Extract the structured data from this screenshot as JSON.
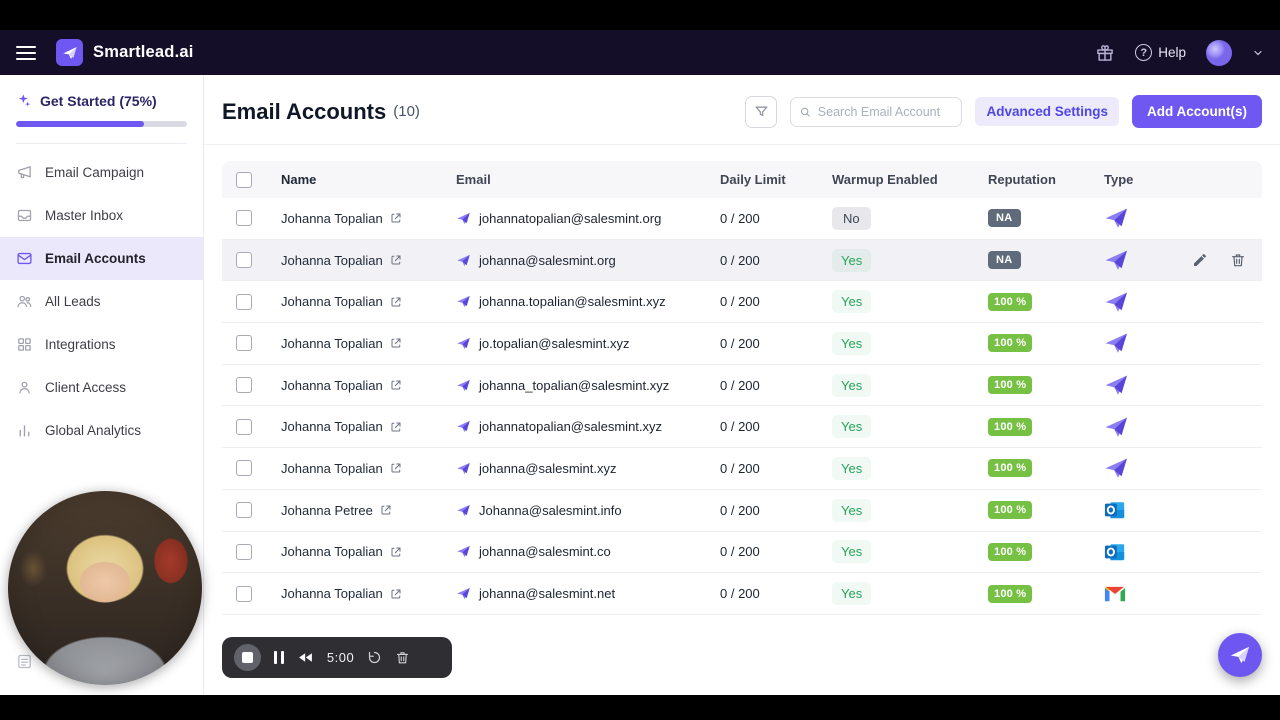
{
  "topbar": {
    "brand": "Smartlead.ai",
    "help_label": "Help",
    "icons": [
      "hamburger-icon",
      "smartlead-logo",
      "gift-icon",
      "help-icon",
      "avatar",
      "chevron-down-icon"
    ]
  },
  "sidebar": {
    "get_started": {
      "label": "Get Started (75%)",
      "progress_pct": 75,
      "icon": "sparkle-icon"
    },
    "items": [
      {
        "label": "Email Campaign",
        "icon": "megaphone-icon",
        "active": false
      },
      {
        "label": "Master Inbox",
        "icon": "inbox-icon",
        "active": false
      },
      {
        "label": "Email Accounts",
        "icon": "envelope-icon",
        "active": true
      },
      {
        "label": "All Leads",
        "icon": "users-icon",
        "active": false
      },
      {
        "label": "Integrations",
        "icon": "grid-icon",
        "active": false
      },
      {
        "label": "Client Access",
        "icon": "person-icon",
        "active": false
      },
      {
        "label": "Global Analytics",
        "icon": "bar-chart-icon",
        "active": false
      }
    ]
  },
  "header": {
    "title": "Email Accounts",
    "count": "(10)",
    "filter_icon": "funnel-icon",
    "search_placeholder": "Search Email Account",
    "advanced_settings_label": "Advanced Settings",
    "add_account_label": "Add Account(s)"
  },
  "table": {
    "columns": [
      "Name",
      "Email",
      "Daily Limit",
      "Warmup Enabled",
      "Reputation",
      "Type"
    ],
    "rows": [
      {
        "name": "Johanna Topalian",
        "email": "johannatopalian@salesmint.org",
        "daily_limit": "0 / 200",
        "warmup": "No",
        "reputation": "NA",
        "type": "smartlead",
        "highlighted": false
      },
      {
        "name": "Johanna Topalian",
        "email": "johanna@salesmint.org",
        "daily_limit": "0 / 200",
        "warmup": "Yes",
        "reputation": "NA",
        "type": "smartlead",
        "highlighted": true
      },
      {
        "name": "Johanna Topalian",
        "email": "johanna.topalian@salesmint.xyz",
        "daily_limit": "0 / 200",
        "warmup": "Yes",
        "reputation": "100 %",
        "type": "smartlead",
        "highlighted": false
      },
      {
        "name": "Johanna Topalian",
        "email": "jo.topalian@salesmint.xyz",
        "daily_limit": "0 / 200",
        "warmup": "Yes",
        "reputation": "100 %",
        "type": "smartlead",
        "highlighted": false
      },
      {
        "name": "Johanna Topalian",
        "email": "johanna_topalian@salesmint.xyz",
        "daily_limit": "0 / 200",
        "warmup": "Yes",
        "reputation": "100 %",
        "type": "smartlead",
        "highlighted": false
      },
      {
        "name": "Johanna Topalian",
        "email": "johannatopalian@salesmint.xyz",
        "daily_limit": "0 / 200",
        "warmup": "Yes",
        "reputation": "100 %",
        "type": "smartlead",
        "highlighted": false
      },
      {
        "name": "Johanna Topalian",
        "email": "johanna@salesmint.xyz",
        "daily_limit": "0 / 200",
        "warmup": "Yes",
        "reputation": "100 %",
        "type": "smartlead",
        "highlighted": false
      },
      {
        "name": "Johanna Petree",
        "email": "Johanna@salesmint.info",
        "daily_limit": "0 / 200",
        "warmup": "Yes",
        "reputation": "100 %",
        "type": "outlook",
        "highlighted": false
      },
      {
        "name": "Johanna Topalian",
        "email": "johanna@salesmint.co",
        "daily_limit": "0 / 200",
        "warmup": "Yes",
        "reputation": "100 %",
        "type": "outlook",
        "highlighted": false
      },
      {
        "name": "Johanna Topalian",
        "email": "johanna@salesmint.net",
        "daily_limit": "0 / 200",
        "warmup": "Yes",
        "reputation": "100 %",
        "type": "gmail",
        "highlighted": false
      }
    ],
    "row_action_icons": [
      "pencil-icon",
      "trash-icon"
    ]
  },
  "recorder": {
    "time": "5:00",
    "icons": [
      "stop-icon",
      "pause-icon",
      "rewind-icon",
      "restart-icon",
      "trash-icon"
    ]
  },
  "webcam": {
    "description": "presenter webcam bubble"
  },
  "fab": {
    "icon": "smartlead-chat-icon"
  },
  "colors": {
    "accent_purple": "#6e58f1",
    "topbar_bg": "#140e29",
    "active_item_bg": "#ebe8fc",
    "success_green": "#27a45a",
    "reputation_green": "#76c043",
    "na_badge_gray": "#5f6b7a",
    "no_badge_gray": "#e7e7ec"
  }
}
